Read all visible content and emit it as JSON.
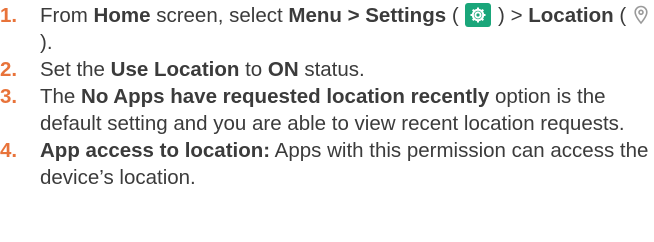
{
  "steps": [
    {
      "number": "1.",
      "t1": "From ",
      "b1": "Home",
      "t2": " screen, select ",
      "b2": "Menu > Settings",
      "t3": " ( ",
      "settings_icon": "gear-settings-icon",
      "t4": " ) > ",
      "b3": "Location",
      "t5": " ( ",
      "location_icon": "location-pin-icon",
      "t6": " )."
    },
    {
      "number": "2.",
      "t1": "Set the ",
      "b1": "Use Location",
      "t2": " to ",
      "b2": "ON",
      "t3": " status."
    },
    {
      "number": "3.",
      "t1": "The ",
      "b1": "No Apps have requested location recently",
      "t2": " option is the default setting and you are able to view recent location requests."
    },
    {
      "number": "4.",
      "b1": "App access to location:",
      "t1": " Apps with this permission can access the device’s location."
    }
  ],
  "colors": {
    "number": "#e8733a",
    "text": "#3b3b3b",
    "settings_icon_bg": "#1aa67a"
  }
}
